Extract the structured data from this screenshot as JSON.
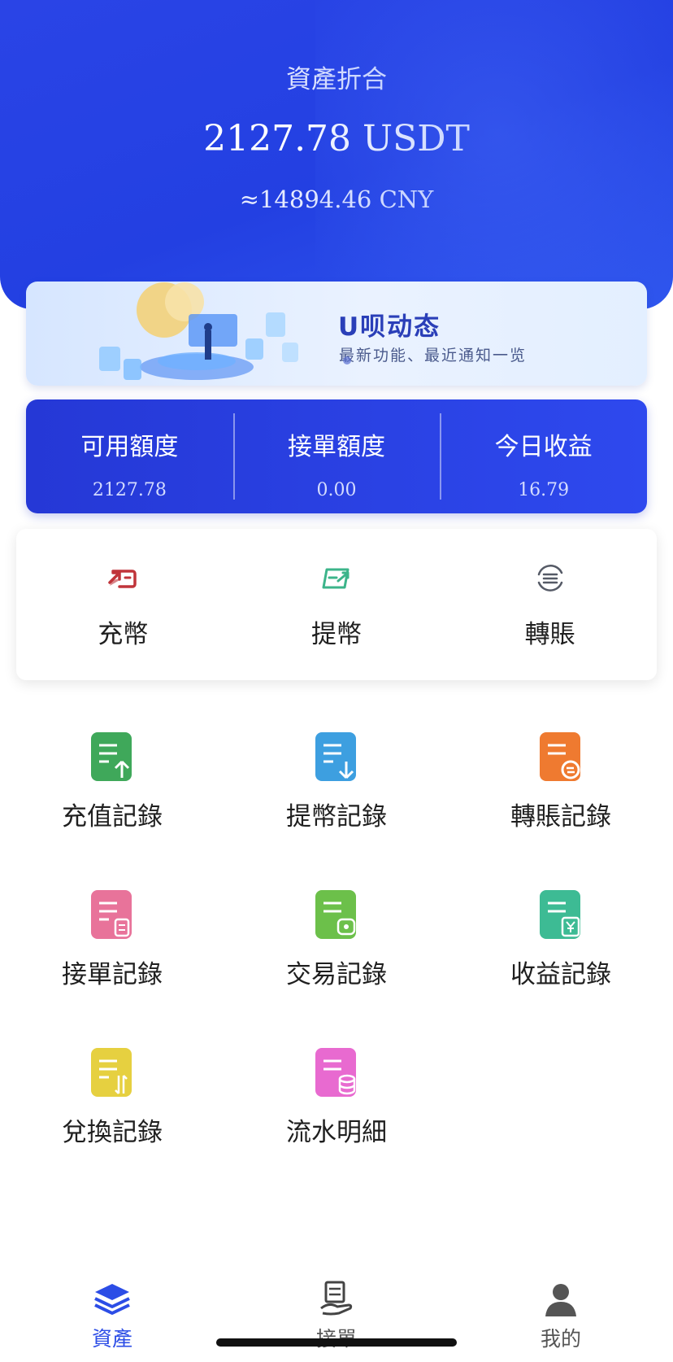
{
  "header": {
    "title": "資產折合",
    "amount": "2127.78 USDT",
    "cny": "≈14894.46 CNY"
  },
  "banner": {
    "title": "U呗动态",
    "subtitle": "最新功能、最近通知一览"
  },
  "stats": [
    {
      "label": "可用額度",
      "value": "2127.78"
    },
    {
      "label": "接單額度",
      "value": "0.00"
    },
    {
      "label": "今日收益",
      "value": "16.79"
    }
  ],
  "actions": [
    {
      "label": "充幣",
      "icon": "deposit-icon",
      "color": "#c0343a"
    },
    {
      "label": "提幣",
      "icon": "withdraw-icon",
      "color": "#3cb48a"
    },
    {
      "label": "轉賬",
      "icon": "transfer-icon",
      "color": "#555a66"
    }
  ],
  "records": [
    {
      "label": "充值記錄",
      "icon": "deposit-record-icon",
      "color": "#3fa85a"
    },
    {
      "label": "提幣記錄",
      "icon": "withdraw-record-icon",
      "color": "#3d9fe0"
    },
    {
      "label": "轉賬記錄",
      "icon": "transfer-record-icon",
      "color": "#ef7a30"
    },
    {
      "label": "接單記錄",
      "icon": "order-record-icon",
      "color": "#e8739a"
    },
    {
      "label": "交易記錄",
      "icon": "trade-record-icon",
      "color": "#6cc04a"
    },
    {
      "label": "收益記錄",
      "icon": "earnings-record-icon",
      "color": "#3dbb94"
    },
    {
      "label": "兌換記錄",
      "icon": "exchange-record-icon",
      "color": "#e6d040"
    },
    {
      "label": "流水明細",
      "icon": "ledger-detail-icon",
      "color": "#e86ad0"
    }
  ],
  "nav": [
    {
      "label": "資產",
      "icon": "assets-layers-icon",
      "active": true
    },
    {
      "label": "接單",
      "icon": "orders-icon",
      "active": false
    },
    {
      "label": "我的",
      "icon": "profile-icon",
      "active": false
    }
  ],
  "colors": {
    "primary": "#2a44e6",
    "nav_active": "#2c4de6"
  }
}
